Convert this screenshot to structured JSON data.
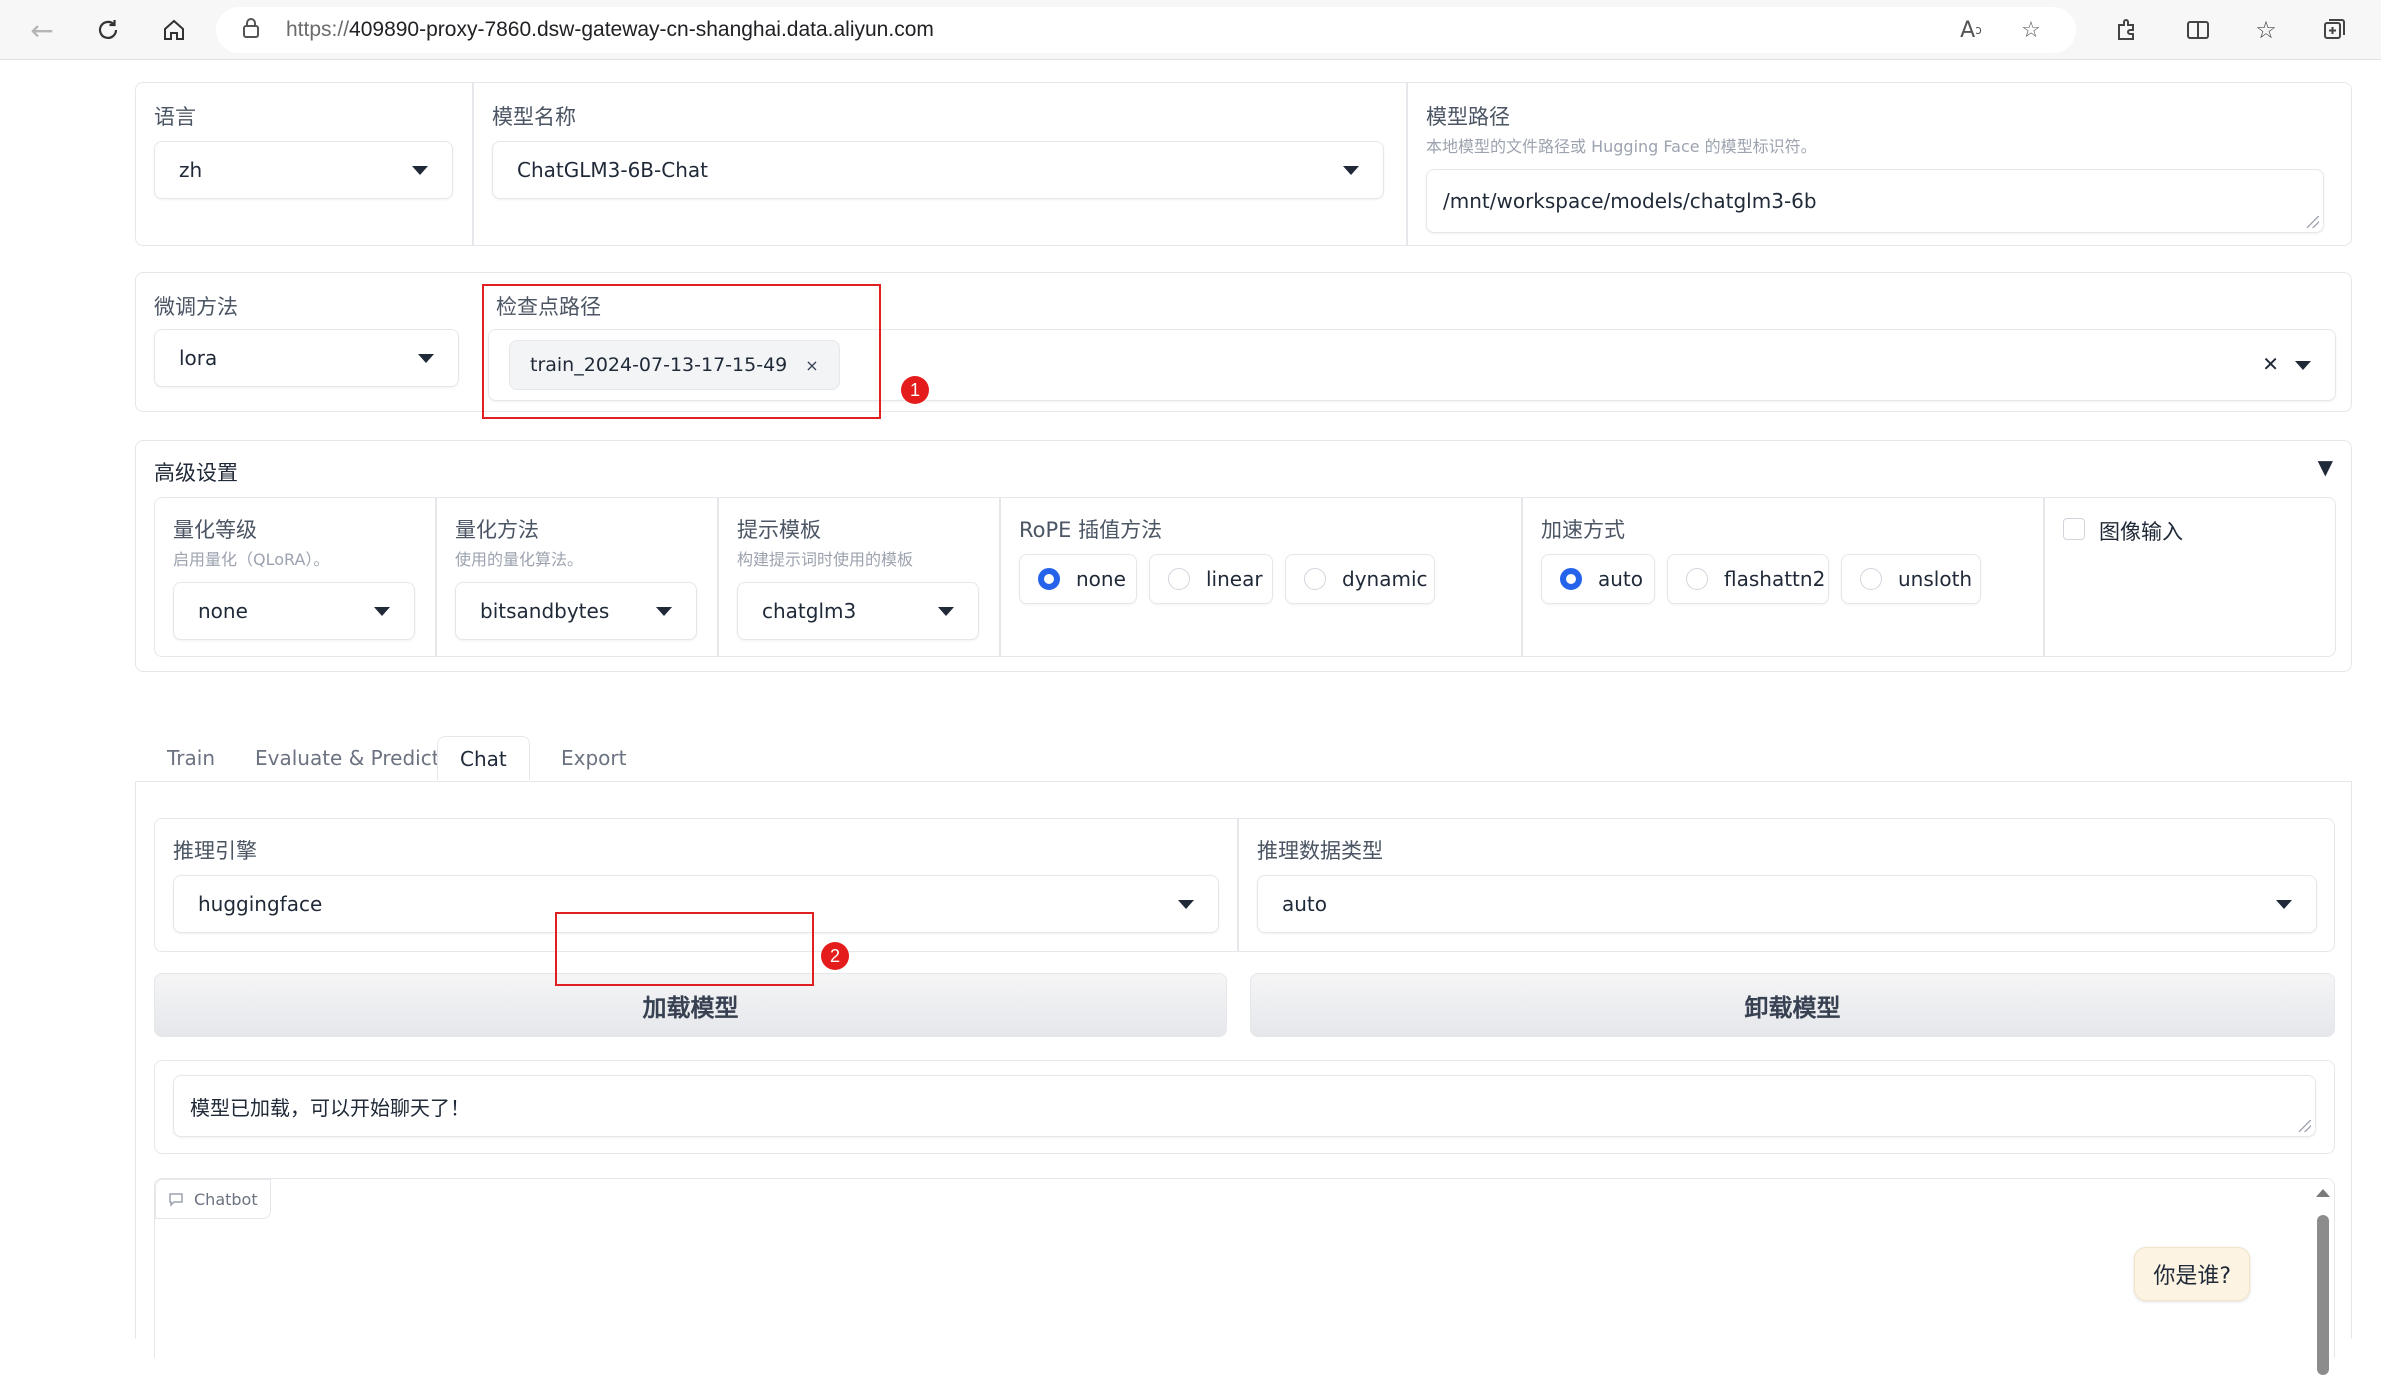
{
  "browser": {
    "url_protocol": "https://",
    "url_rest": "409890-proxy-7860.dsw-gateway-cn-shanghai.data.aliyun.com"
  },
  "top": {
    "lang": {
      "label": "语言",
      "value": "zh"
    },
    "model_name": {
      "label": "模型名称",
      "value": "ChatGLM3-6B-Chat"
    },
    "model_path": {
      "label": "模型路径",
      "info": "本地模型的文件路径或 Hugging Face 的模型标识符。",
      "value": "/mnt/workspace/models/chatglm3-6b"
    }
  },
  "finetune": {
    "method": {
      "label": "微调方法",
      "value": "lora"
    },
    "checkpoint": {
      "label": "检查点路径",
      "chip": "train_2024-07-13-17-15-49",
      "chip_remove": "×",
      "clear": "✕"
    }
  },
  "advanced": {
    "title": "高级设置",
    "toggle": "▼",
    "quant_bit": {
      "label": "量化等级",
      "info": "启用量化（QLoRA）。",
      "value": "none"
    },
    "quant_method": {
      "label": "量化方法",
      "info": "使用的量化算法。",
      "value": "bitsandbytes"
    },
    "template": {
      "label": "提示模板",
      "info": "构建提示词时使用的模板",
      "value": "chatglm3"
    },
    "rope": {
      "label": "RoPE 插值方法",
      "options": [
        "none",
        "linear",
        "dynamic"
      ],
      "selected": "none"
    },
    "booster": {
      "label": "加速方式",
      "options": [
        "auto",
        "flashattn2",
        "unsloth"
      ],
      "selected": "auto"
    },
    "visual": {
      "label": "图像输入",
      "checked": false
    }
  },
  "tabs": [
    "Train",
    "Evaluate & Predict",
    "Chat",
    "Export"
  ],
  "active_tab": "Chat",
  "chat": {
    "engine": {
      "label": "推理引擎",
      "value": "huggingface"
    },
    "dtype": {
      "label": "推理数据类型",
      "value": "auto"
    },
    "load_button": "加载模型",
    "unload_button": "卸载模型",
    "info_text": "模型已加载，可以开始聊天了！",
    "chatbot_label": "Chatbot",
    "messages": [
      {
        "role": "user",
        "text": "你是谁?"
      }
    ]
  },
  "annotations": {
    "badge1": "1",
    "badge2": "2",
    "box_color": "#e02020"
  },
  "colors": {
    "accent": "#2563eb",
    "border": "#e5e7eb"
  }
}
